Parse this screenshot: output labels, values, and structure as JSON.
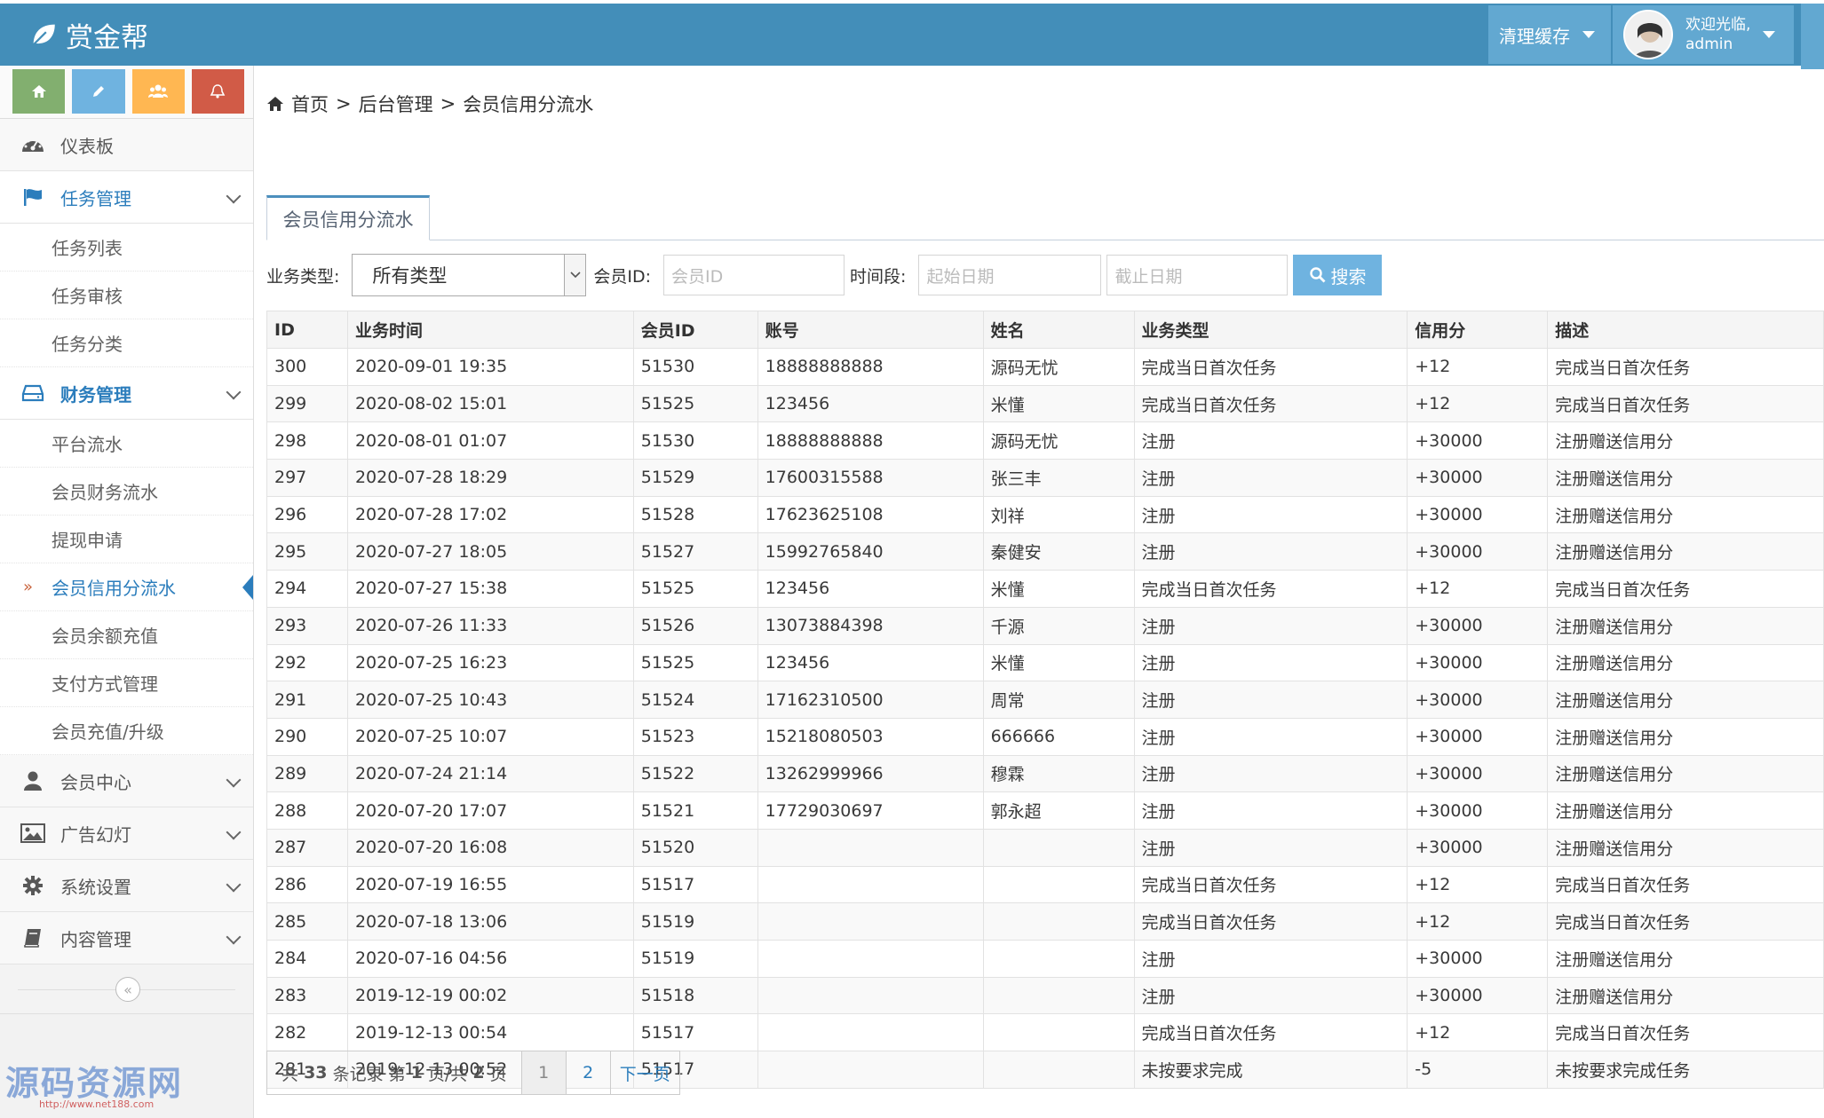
{
  "app": {
    "brand": "赏金帮"
  },
  "topbar": {
    "clear_cache": "清理缓存",
    "welcome": "欢迎光临,",
    "username": "admin"
  },
  "shortcuts": [
    {
      "icon": "home-icon",
      "color": "#82af6f"
    },
    {
      "icon": "pencil-icon",
      "color": "#6fb3e0"
    },
    {
      "icon": "group-icon",
      "color": "#ffb752"
    },
    {
      "icon": "bell-icon",
      "color": "#d15b47"
    }
  ],
  "sidebar": {
    "dashboard": "仪表板",
    "task_mgmt": "任务管理",
    "task_items": [
      "任务列表",
      "任务审核",
      "任务分类"
    ],
    "finance_mgmt": "财务管理",
    "finance_items": [
      "平台流水",
      "会员财务流水",
      "提现申请",
      "会员信用分流水",
      "会员余额充值",
      "支付方式管理",
      "会员充值/升级"
    ],
    "member_center": "会员中心",
    "ads": "广告幻灯",
    "settings": "系统设置",
    "content": "内容管理"
  },
  "watermark": {
    "text": "源码资源网",
    "url": "http://www.net188.com"
  },
  "breadcrumb": {
    "home": "首页",
    "admin": "后台管理",
    "current": "会员信用分流水",
    "sep": ">"
  },
  "tab": {
    "label": "会员信用分流水"
  },
  "filters": {
    "type_label": "业务类型:",
    "type_value": "所有类型",
    "member_label": "会员ID:",
    "member_placeholder": "会员ID",
    "period_label": "时间段:",
    "start_placeholder": "起始日期",
    "end_placeholder": "截止日期",
    "search": "搜索"
  },
  "table": {
    "headers": [
      "ID",
      "业务时间",
      "会员ID",
      "账号",
      "姓名",
      "业务类型",
      "信用分",
      "描述"
    ],
    "rows": [
      [
        "300",
        "2020-09-01 19:35",
        "51530",
        "18888888888",
        "源码无忧",
        "完成当日首次任务",
        "+12",
        "完成当日首次任务"
      ],
      [
        "299",
        "2020-08-02 15:01",
        "51525",
        "123456",
        "米懂",
        "完成当日首次任务",
        "+12",
        "完成当日首次任务"
      ],
      [
        "298",
        "2020-08-01 01:07",
        "51530",
        "18888888888",
        "源码无忧",
        "注册",
        "+30000",
        "注册赠送信用分"
      ],
      [
        "297",
        "2020-07-28 18:29",
        "51529",
        "17600315588",
        "张三丰",
        "注册",
        "+30000",
        "注册赠送信用分"
      ],
      [
        "296",
        "2020-07-28 17:02",
        "51528",
        "17623625108",
        "刘祥",
        "注册",
        "+30000",
        "注册赠送信用分"
      ],
      [
        "295",
        "2020-07-27 18:05",
        "51527",
        "15992765840",
        "秦健安",
        "注册",
        "+30000",
        "注册赠送信用分"
      ],
      [
        "294",
        "2020-07-27 15:38",
        "51525",
        "123456",
        "米懂",
        "完成当日首次任务",
        "+12",
        "完成当日首次任务"
      ],
      [
        "293",
        "2020-07-26 11:33",
        "51526",
        "13073884398",
        "千源",
        "注册",
        "+30000",
        "注册赠送信用分"
      ],
      [
        "292",
        "2020-07-25 16:23",
        "51525",
        "123456",
        "米懂",
        "注册",
        "+30000",
        "注册赠送信用分"
      ],
      [
        "291",
        "2020-07-25 10:43",
        "51524",
        "17162310500",
        "周常",
        "注册",
        "+30000",
        "注册赠送信用分"
      ],
      [
        "290",
        "2020-07-25 10:07",
        "51523",
        "15218080503",
        "666666",
        "注册",
        "+30000",
        "注册赠送信用分"
      ],
      [
        "289",
        "2020-07-24 21:14",
        "51522",
        "13262999966",
        "穆霖",
        "注册",
        "+30000",
        "注册赠送信用分"
      ],
      [
        "288",
        "2020-07-20 17:07",
        "51521",
        "17729030697",
        "郭永超",
        "注册",
        "+30000",
        "注册赠送信用分"
      ],
      [
        "287",
        "2020-07-20 16:08",
        "51520",
        "",
        "",
        "注册",
        "+30000",
        "注册赠送信用分"
      ],
      [
        "286",
        "2020-07-19 16:55",
        "51517",
        "",
        "",
        "完成当日首次任务",
        "+12",
        "完成当日首次任务"
      ],
      [
        "285",
        "2020-07-18 13:06",
        "51519",
        "",
        "",
        "完成当日首次任务",
        "+12",
        "完成当日首次任务"
      ],
      [
        "284",
        "2020-07-16 04:56",
        "51519",
        "",
        "",
        "注册",
        "+30000",
        "注册赠送信用分"
      ],
      [
        "283",
        "2019-12-19 00:02",
        "51518",
        "",
        "",
        "注册",
        "+30000",
        "注册赠送信用分"
      ],
      [
        "282",
        "2019-12-13 00:54",
        "51517",
        "",
        "",
        "完成当日首次任务",
        "+12",
        "完成当日首次任务"
      ],
      [
        "281",
        "2019-12-13 00:52",
        "51517",
        "",
        "",
        "未按要求完成",
        "-5",
        "未按要求完成任务"
      ]
    ]
  },
  "pager": {
    "info_prefix": "共",
    "total": "33",
    "info_mid1": "条记录 第",
    "page": "1",
    "info_mid2": "页/共",
    "pages": "2",
    "info_suffix": "页",
    "p1": "1",
    "p2": "2",
    "next": "下一页"
  },
  "colors": {
    "topbar": "#438eb9",
    "accent": "#2b7dbc",
    "search": "#6fb3e0"
  }
}
